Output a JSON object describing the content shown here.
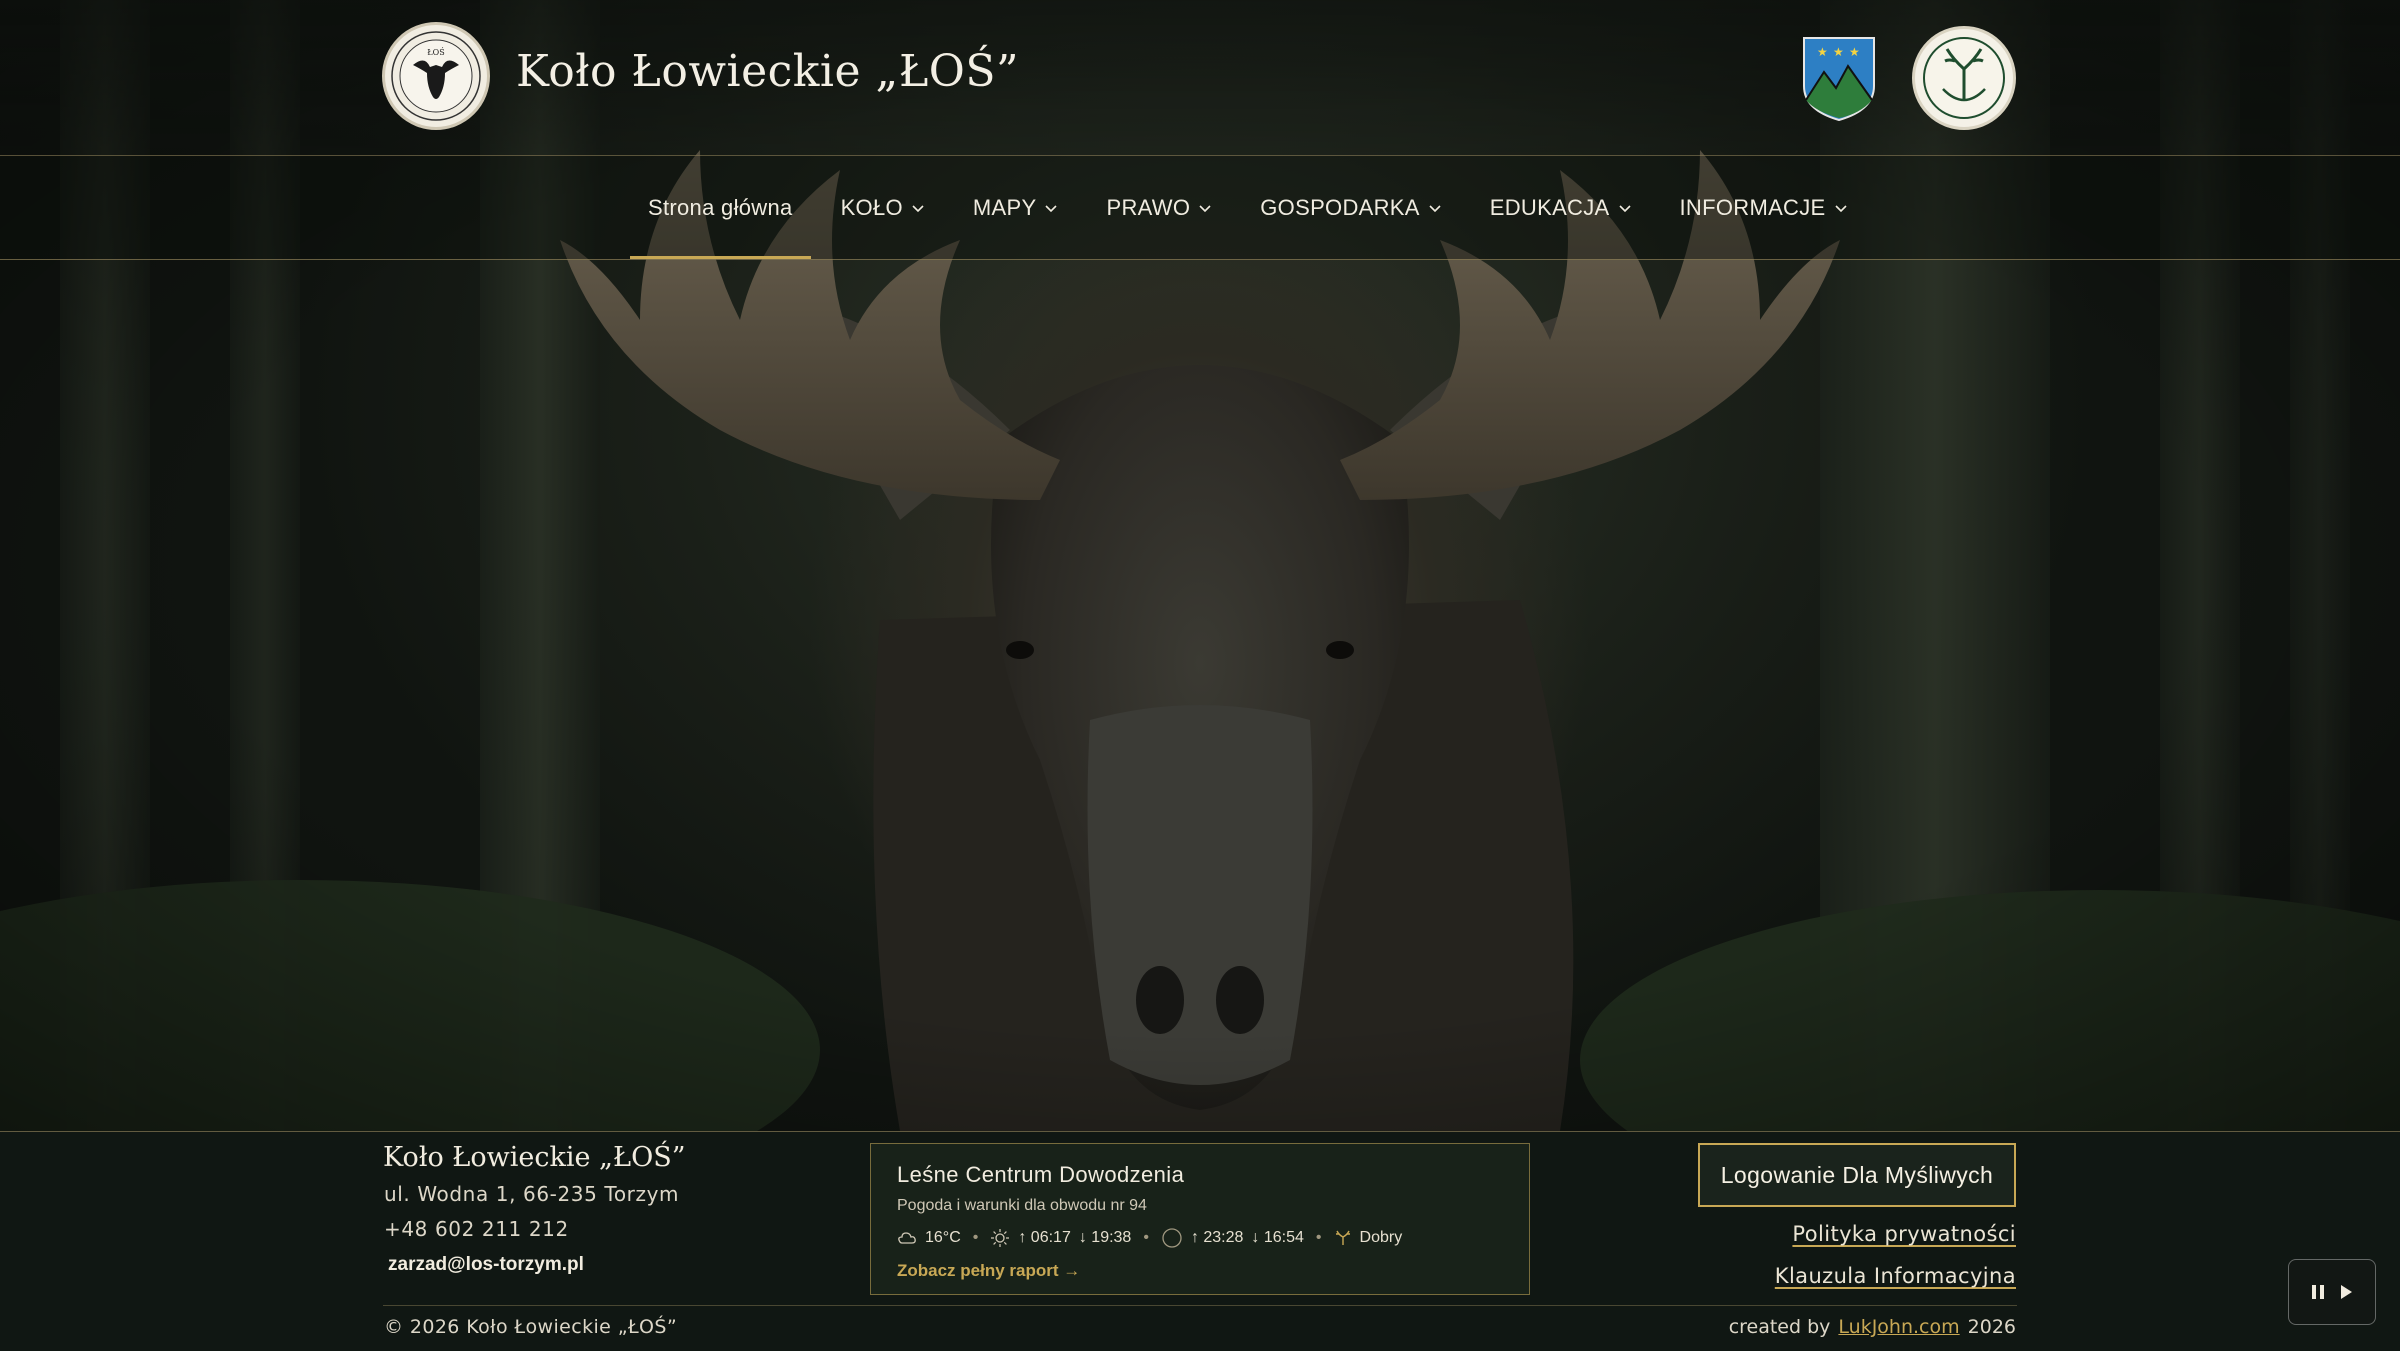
{
  "site": {
    "title": "Koło Łowieckie „ŁOŚ”"
  },
  "nav": {
    "items": [
      {
        "label": "Strona główna",
        "active": true,
        "has_dropdown": false
      },
      {
        "label": "KOŁO",
        "active": false,
        "has_dropdown": true
      },
      {
        "label": "MAPY",
        "active": false,
        "has_dropdown": true
      },
      {
        "label": "PRAWO",
        "active": false,
        "has_dropdown": true
      },
      {
        "label": "GOSPODARKA",
        "active": false,
        "has_dropdown": true
      },
      {
        "label": "EDUKACJA",
        "active": false,
        "has_dropdown": true
      },
      {
        "label": "INFORMACJE",
        "active": false,
        "has_dropdown": true
      }
    ]
  },
  "footer": {
    "org_name": "Koło Łowieckie „ŁOŚ”",
    "address": "ul. Wodna 1, 66-235 Torzym",
    "phone": "+48 602 211 212",
    "email": "zarzad@los-torzym.pl",
    "copyright": "© 2026 Koło Łowieckie „ŁOŚ”",
    "credit_prefix": "created by",
    "credit_link": "LukJohn.com",
    "credit_year": "2026",
    "login_button": "Logowanie Dla Myśliwych",
    "privacy_link": "Polityka prywatności",
    "info_clause_link": "Klauzula Informacyjna"
  },
  "weather_card": {
    "title": "Leśne Centrum Dowodzenia",
    "subtitle": "Pogoda i warunki dla obwodu nr 94",
    "temperature": "16°C",
    "sunrise": "↑ 06:17",
    "sunset": "↓ 19:38",
    "moonrise": "↑ 23:28",
    "moonset": "↓ 16:54",
    "condition": "Dobry",
    "report_link": "Zobacz pełny raport →"
  },
  "icons": {
    "weather": "cloud-icon",
    "sun": "sun-icon",
    "moon": "moon-icon",
    "hunting": "deer-antler-icon",
    "media": "pause-play-icon"
  },
  "colors": {
    "accent": "#c8a855",
    "background": "#101713",
    "text": "#f1ecdf"
  }
}
